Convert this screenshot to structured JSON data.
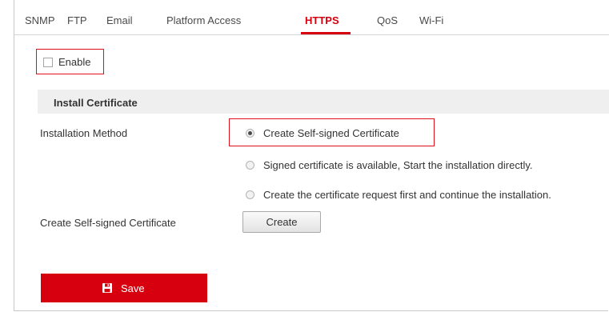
{
  "tabs": [
    {
      "label": "SNMP",
      "active": false
    },
    {
      "label": "FTP",
      "active": false
    },
    {
      "label": "Email",
      "active": false
    },
    {
      "label": "Platform Access",
      "active": false
    },
    {
      "label": "HTTPS",
      "active": true
    },
    {
      "label": "QoS",
      "active": false
    },
    {
      "label": "Wi-Fi",
      "active": false
    }
  ],
  "enable": {
    "label": "Enable",
    "checked": false
  },
  "section": {
    "title": "Install Certificate"
  },
  "installation_method": {
    "label": "Installation Method",
    "options": [
      {
        "label": "Create Self-signed Certificate",
        "selected": true
      },
      {
        "label": "Signed certificate is available, Start the installation directly.",
        "selected": false
      },
      {
        "label": "Create the certificate request first and continue the installation.",
        "selected": false
      }
    ]
  },
  "self_signed": {
    "label": "Create Self-signed Certificate",
    "button_label": "Create"
  },
  "save": {
    "label": "Save",
    "icon": "save-icon"
  },
  "colors": {
    "accent": "#d6000f",
    "highlight_border": "#e0101a",
    "section_bg": "#efefef"
  }
}
